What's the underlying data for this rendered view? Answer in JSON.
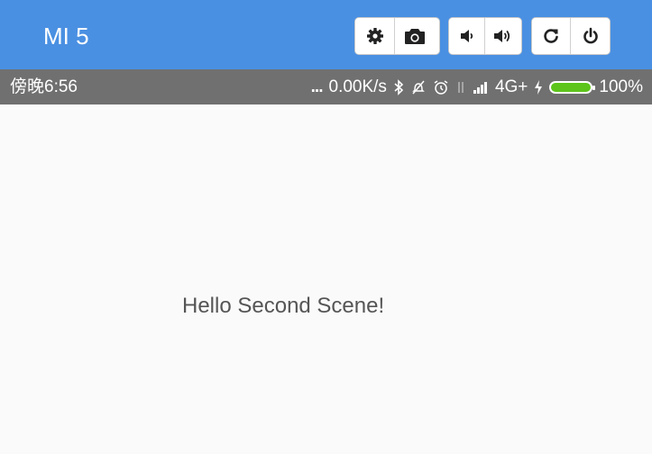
{
  "device": {
    "title": "MI 5"
  },
  "toolbar": {
    "groups": [
      {
        "name": "capture",
        "buttons": [
          {
            "icon": "gear-icon",
            "label": ""
          },
          {
            "icon": "camera-icon",
            "label": ""
          }
        ]
      },
      {
        "name": "volume",
        "buttons": [
          {
            "icon": "volume-down-icon",
            "label": ""
          },
          {
            "icon": "volume-up-icon",
            "label": ""
          }
        ]
      },
      {
        "name": "power",
        "buttons": [
          {
            "icon": "rotate-icon",
            "label": ""
          },
          {
            "icon": "power-icon",
            "label": ""
          }
        ]
      }
    ]
  },
  "status_bar": {
    "time": "傍晚6:56",
    "more": "...",
    "network_speed": "0.00K/s",
    "network_type": "4G+",
    "battery": "100%",
    "icons": [
      "bluetooth-icon",
      "no-disturb-icon",
      "alarm-icon",
      "data-transfer-icon",
      "signal-icon",
      "charging-icon",
      "battery-icon"
    ]
  },
  "screen": {
    "message": "Hello Second Scene!"
  },
  "colors": {
    "header_bg": "#4a90e2",
    "statusbar_bg": "#707070",
    "screen_bg": "#fafafa",
    "battery_fill": "#5cc41a",
    "message_text": "#555555"
  }
}
